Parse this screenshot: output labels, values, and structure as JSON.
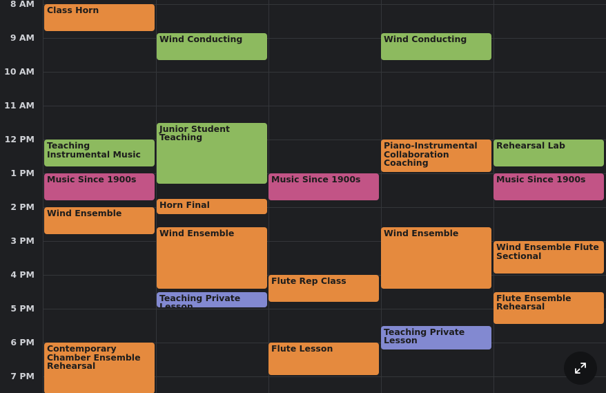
{
  "colors": {
    "background": "#1e1f22",
    "grid": "#34363a",
    "time_text": "#cfd1d6",
    "orange": "#e58a3e",
    "green": "#8dba5f",
    "magenta": "#c25486",
    "blue": "#8289d1"
  },
  "time_labels": [
    "8 AM",
    "9 AM",
    "10 AM",
    "11 AM",
    "12 PM",
    "1 PM",
    "2 PM",
    "3 PM",
    "4 PM",
    "5 PM",
    "6 PM",
    "7 PM"
  ],
  "events": [
    {
      "day_index": 0,
      "title": "Class Horn",
      "color": "orange"
    },
    {
      "day_index": 0,
      "title": "Teaching Instrumental Music",
      "color": "green"
    },
    {
      "day_index": 0,
      "title": "Music Since 1900s",
      "color": "magenta"
    },
    {
      "day_index": 0,
      "title": "Wind Ensemble",
      "color": "orange"
    },
    {
      "day_index": 0,
      "title": "Contemporary Chamber Ensemble Rehearsal",
      "color": "orange"
    },
    {
      "day_index": 1,
      "title": "Wind Conducting",
      "color": "green"
    },
    {
      "day_index": 1,
      "title": "Junior Student Teaching",
      "color": "green"
    },
    {
      "day_index": 1,
      "title": "Horn Final",
      "color": "orange"
    },
    {
      "day_index": 1,
      "title": "Wind Ensemble",
      "color": "orange"
    },
    {
      "day_index": 1,
      "title": "Teaching Private Lesson",
      "color": "blue"
    },
    {
      "day_index": 2,
      "title": "Music Since 1900s",
      "color": "magenta"
    },
    {
      "day_index": 2,
      "title": "Flute Rep Class",
      "color": "orange"
    },
    {
      "day_index": 2,
      "title": "Flute Lesson",
      "color": "orange"
    },
    {
      "day_index": 3,
      "title": "Wind Conducting",
      "color": "green"
    },
    {
      "day_index": 3,
      "title": "Piano-Instrumental Collaboration Coaching",
      "color": "orange"
    },
    {
      "day_index": 3,
      "title": "Wind Ensemble",
      "color": "orange"
    },
    {
      "day_index": 3,
      "title": "Teaching Private Lesson",
      "color": "blue"
    },
    {
      "day_index": 4,
      "title": "Rehearsal Lab",
      "color": "green"
    },
    {
      "day_index": 4,
      "title": "Music Since 1900s",
      "color": "magenta"
    },
    {
      "day_index": 4,
      "title": "Wind Ensemble Flute Sectional",
      "color": "orange"
    },
    {
      "day_index": 4,
      "title": "Flute Ensemble Rehearsal",
      "color": "orange"
    }
  ],
  "fullscreen_icon": "expand-arrows-icon"
}
